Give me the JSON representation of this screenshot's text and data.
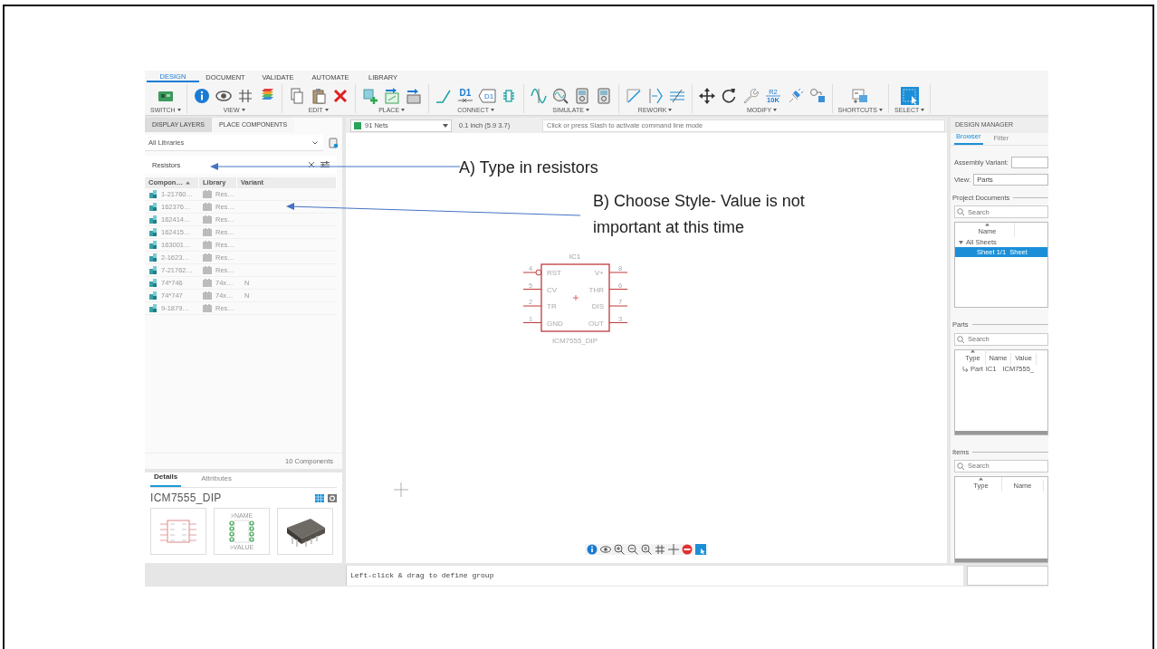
{
  "ribbon": {
    "tabs": [
      {
        "label": "DESIGN",
        "selected": true
      },
      {
        "label": "DOCUMENT",
        "selected": false
      },
      {
        "label": "VALIDATE",
        "selected": false
      },
      {
        "label": "AUTOMATE",
        "selected": false
      },
      {
        "label": "LIBRARY",
        "selected": false
      }
    ],
    "groups": [
      {
        "label": "SWITCH",
        "tools": [
          {
            "kind": "board"
          }
        ]
      },
      {
        "label": "VIEW",
        "tools": [
          {
            "kind": "info"
          },
          {
            "kind": "eye"
          },
          {
            "kind": "grid"
          },
          {
            "kind": "layers"
          }
        ]
      },
      {
        "label": "EDIT",
        "tools": [
          {
            "kind": "copy"
          },
          {
            "kind": "paste"
          },
          {
            "kind": "cross"
          }
        ]
      },
      {
        "label": "PLACE",
        "tools": [
          {
            "kind": "part-add"
          },
          {
            "kind": "image-arrow"
          },
          {
            "kind": "box-arrow"
          }
        ]
      },
      {
        "label": "CONNECT",
        "tools": [
          {
            "kind": "wire"
          },
          {
            "kind": "net-label",
            "text": "D1"
          },
          {
            "kind": "tag",
            "text": "D1"
          },
          {
            "kind": "connector"
          }
        ]
      },
      {
        "label": "SIMULATE",
        "tools": [
          {
            "kind": "sine"
          },
          {
            "kind": "probe"
          },
          {
            "kind": "meter"
          },
          {
            "kind": "meter"
          }
        ]
      },
      {
        "label": "REWORK",
        "tools": [
          {
            "kind": "diagonal"
          },
          {
            "kind": "arrow-bar"
          },
          {
            "kind": "strike"
          }
        ]
      },
      {
        "label": "MODIFY",
        "tools": [
          {
            "kind": "move"
          },
          {
            "kind": "rotate"
          },
          {
            "kind": "wrench"
          },
          {
            "kind": "value",
            "text": "R2",
            "text2": "10K"
          },
          {
            "kind": "plug"
          },
          {
            "kind": "group"
          }
        ]
      },
      {
        "label": "SHORTCUTS",
        "tools": [
          {
            "kind": "shortcut"
          }
        ]
      },
      {
        "label": "SELECT",
        "tools": [
          {
            "kind": "select"
          }
        ]
      }
    ]
  },
  "left_panel": {
    "tabs": [
      {
        "label": "DISPLAY LAYERS",
        "selected": false
      },
      {
        "label": "PLACE COMPONENTS",
        "selected": true
      }
    ],
    "library_select": {
      "value": "All Libraries"
    },
    "search": {
      "value": "Resistors"
    },
    "columns": [
      {
        "label": "Compon…",
        "sorted": true
      },
      {
        "label": "Library",
        "sorted": false
      },
      {
        "label": "Variant",
        "sorted": false
      }
    ],
    "rows": [
      {
        "component": "1-21760…",
        "library": "Res…"
      },
      {
        "component": "162376…",
        "library": "Res…"
      },
      {
        "component": "162414…",
        "library": "Res…"
      },
      {
        "component": "162415…",
        "library": "Res…"
      },
      {
        "component": "163001…",
        "library": "Res…"
      },
      {
        "component": "2-1623…",
        "library": "Res…"
      },
      {
        "component": "7-21762…",
        "library": "Res…"
      },
      {
        "component": "74*746",
        "library": "74x…",
        "variant": "N"
      },
      {
        "component": "74*747",
        "library": "74x…",
        "variant": "N"
      },
      {
        "component": "9-1879…",
        "library": "Res…"
      }
    ],
    "footer": "10 Components",
    "details": {
      "tabs": [
        {
          "label": "Details",
          "selected": true
        },
        {
          "label": "Attributes",
          "selected": false
        }
      ],
      "title": "ICM7555_DIP",
      "footprint_name": ">NAME",
      "footprint_value": ">VALUE"
    }
  },
  "canvas": {
    "nets_select": "91 Nets",
    "grid_readout": "0.1 inch (5.9 3.7)",
    "command_placeholder": "Click or press Slash to activate command line mode",
    "symbol": {
      "name": "IC1",
      "value": "ICM7555_DIP",
      "left_pins": [
        {
          "number": "4",
          "label": "RST",
          "inverted": true
        },
        {
          "number": "5",
          "label": "CV",
          "inverted": false
        },
        {
          "number": "2",
          "label": "TR",
          "inverted": false
        },
        {
          "number": "1",
          "label": "GND",
          "inverted": false
        }
      ],
      "right_pins": [
        {
          "number": "8",
          "label": "V+",
          "inverted": false
        },
        {
          "number": "6",
          "label": "THR",
          "inverted": false
        },
        {
          "number": "7",
          "label": "DIS",
          "inverted": false
        },
        {
          "number": "3",
          "label": "OUT",
          "inverted": false
        }
      ]
    }
  },
  "status_bar": {
    "message": "Left-click & drag to define group"
  },
  "design_manager": {
    "title": "DESIGN MANAGER",
    "tabs": [
      {
        "label": "Browser",
        "selected": true
      },
      {
        "label": "Filter",
        "selected": false
      }
    ],
    "assembly_variant_label": "Assembly Variant:",
    "view_label": "View:",
    "view_value": "Parts",
    "sections": [
      {
        "title": "Project Documents",
        "search_placeholder": "Search",
        "columns": [
          {
            "label": "Name",
            "sorted": true
          }
        ],
        "tree": [
          {
            "label": "All Sheets",
            "expanded": true,
            "selected": false,
            "children": [
              {
                "label": "Sheet 1/1  Sheet",
                "selected": true
              }
            ]
          }
        ]
      },
      {
        "title": "Parts",
        "search_placeholder": "Search",
        "columns": [
          {
            "label": "Type",
            "sorted": true
          },
          {
            "label": "Name",
            "sorted": false
          },
          {
            "label": "Value",
            "sorted": false
          }
        ],
        "rows": [
          {
            "type": "Part",
            "name": "IC1",
            "value": "ICM7555_"
          }
        ]
      },
      {
        "title": "Items",
        "search_placeholder": "Search",
        "columns": [
          {
            "label": "Type",
            "sorted": true
          },
          {
            "label": "Name",
            "sorted": false
          }
        ]
      }
    ]
  },
  "annotations": [
    {
      "label": "A) Type in resistors"
    },
    {
      "label": "B) Choose Style- Value is not important at this time"
    }
  ]
}
